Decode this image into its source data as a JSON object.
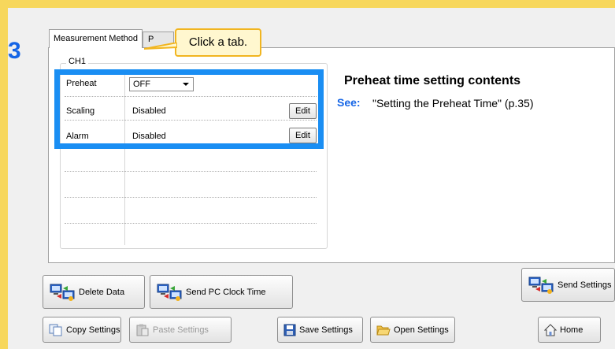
{
  "tabs": {
    "active": "Measurement Method",
    "inactive": "P"
  },
  "callout": {
    "text": "Click a tab."
  },
  "step": {
    "number": "3"
  },
  "channel_group": {
    "title": "CH1",
    "rows": [
      {
        "label": "Preheat",
        "value": "OFF"
      },
      {
        "label": "Scaling",
        "value": "Disabled",
        "button": "Edit"
      },
      {
        "label": "Alarm",
        "value": "Disabled",
        "button": "Edit"
      }
    ]
  },
  "info": {
    "title": "Preheat time setting contents",
    "see_label": "See:",
    "see_text": "\"Setting the Preheat Time\" (p.35)"
  },
  "buttons": {
    "delete_data": "Delete Data",
    "send_pc_clock": "Send PC Clock Time",
    "send_settings": "Send Settings",
    "copy_settings": "Copy Settings",
    "paste_settings": "Paste Settings",
    "save_settings": "Save Settings",
    "open_settings": "Open Settings",
    "home": "Home"
  },
  "colors": {
    "highlight": "#1a8ef3",
    "step_number": "#1565e6",
    "callout_border": "#f1b520",
    "frame": "#f7d75c"
  },
  "icons": {
    "delete_data": "pc-transfer-icon",
    "send_pc_clock": "pc-transfer-icon",
    "send_settings": "pc-transfer-icon",
    "copy_settings": "copy-icon",
    "paste_settings": "paste-icon",
    "save_settings": "save-disk-icon",
    "open_settings": "open-folder-icon",
    "home": "home-icon"
  }
}
